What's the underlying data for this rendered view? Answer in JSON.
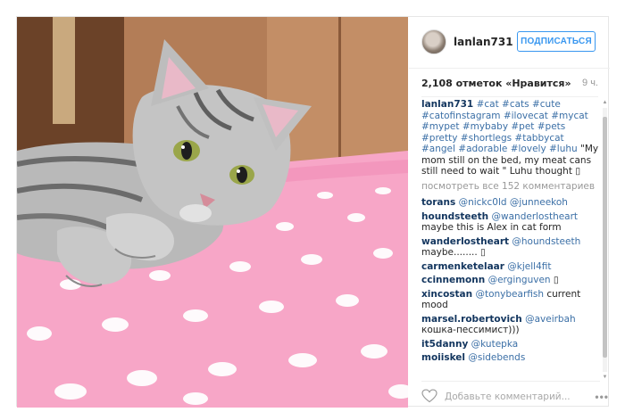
{
  "post": {
    "username": "lanlan731",
    "follow_label": "ПОДПИСАТЬСЯ",
    "likes": "2,108 отметок «Нравится»",
    "time": "9 ч.",
    "caption": {
      "user": "lanlan731",
      "hashtags": "#cat #cats #cute #catofinstagram #ilovecat #mycat #mypet #mybaby #pet #pets #pretty #shortlegs #tabbycat #angel #adorable #lovely #luhu",
      "text": " \"My mom still on the bed, my meat cans still need to wait \" Luhu thought ▯"
    },
    "view_all": "посмотреть все 152 комментариев",
    "comments": [
      {
        "user": "torans",
        "mention": "@nickc0ld @junneekoh",
        "text": ""
      },
      {
        "user": "houndsteeth",
        "mention": "@wanderlostheart",
        "text": " maybe this is Alex in cat form"
      },
      {
        "user": "wanderlostheart",
        "mention": "@houndsteeth",
        "text": " maybe........ ▯"
      },
      {
        "user": "carmenketelaar",
        "mention": "@kjell4fit",
        "text": ""
      },
      {
        "user": "ccinnemonn",
        "mention": "@erginguven",
        "text": " ▯"
      },
      {
        "user": "xincostan",
        "mention": "@tonybearfish",
        "text": " current mood"
      },
      {
        "user": "marsel.robertovich",
        "mention": "@aveirbah",
        "text": " кошка-пессимист)))"
      },
      {
        "user": "it5danny",
        "mention": "@kutepka",
        "text": ""
      },
      {
        "user": "moiiskel",
        "mention": "@sidebends",
        "text": ""
      }
    ],
    "comment_placeholder": "Добавьте комментарий...",
    "more_label": "•••"
  },
  "icons": {
    "heart": "heart-icon",
    "more": "more-options-icon",
    "scroll_up": "scroll-up-arrow-icon",
    "scroll_down": "scroll-down-arrow-icon"
  },
  "colors": {
    "accent": "#3897f0",
    "username": "#12355e",
    "hashtag": "#3b6fa6",
    "bedsheet": "#f7a9c8"
  }
}
